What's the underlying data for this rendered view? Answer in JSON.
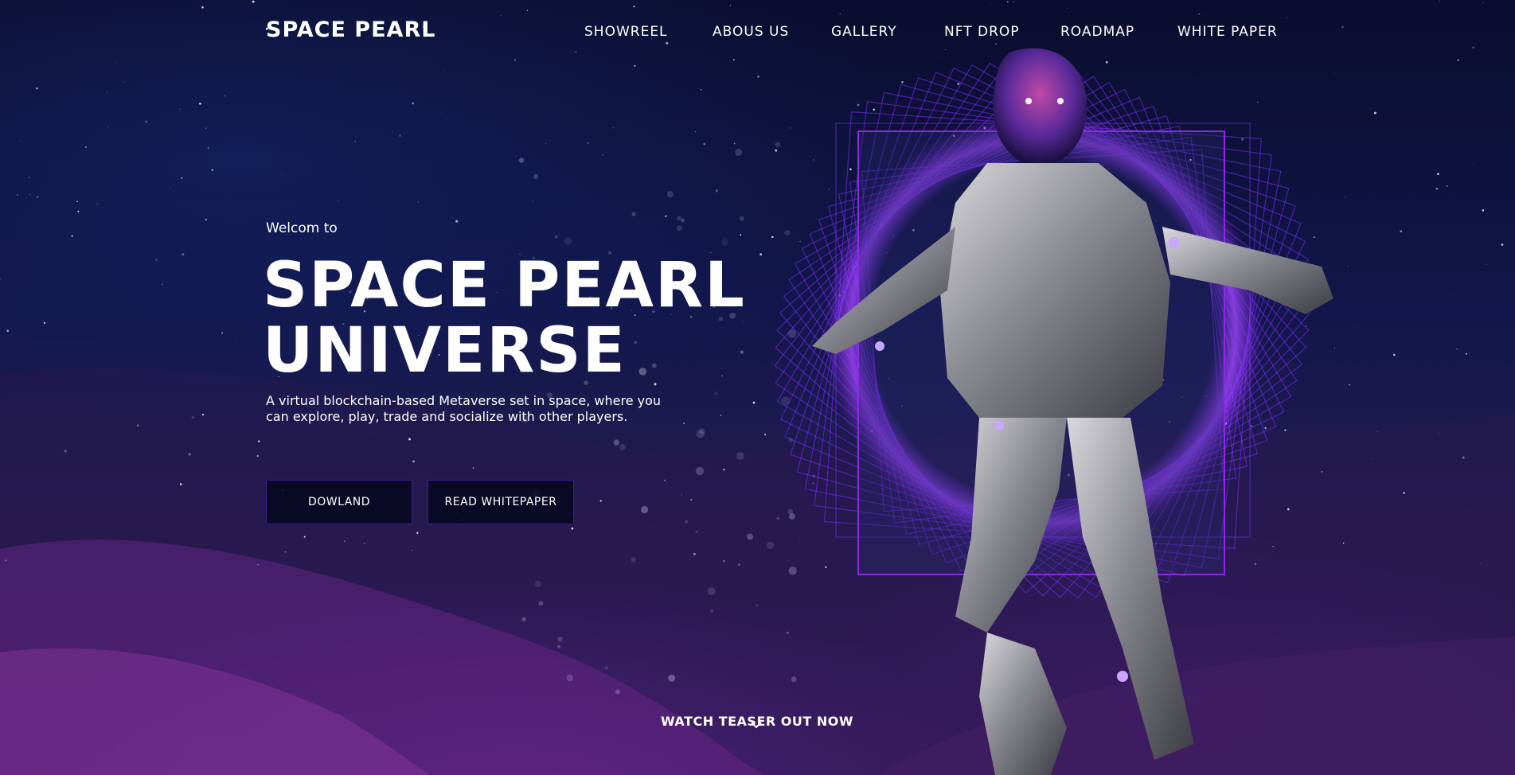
{
  "brand": {
    "logo": "SPACE PEARL"
  },
  "nav": {
    "items": [
      {
        "label": "SHOWREEL"
      },
      {
        "label": "ABOUS US"
      },
      {
        "label": "GALLERY"
      },
      {
        "label": "NFT DROP"
      },
      {
        "label": "ROADMAP"
      },
      {
        "label": "WHITE PAPER"
      }
    ]
  },
  "hero": {
    "welcome": "Welcom to",
    "title_line1": "SPACE PEARL",
    "title_line2": "UNIVERSE",
    "description": "A virtual blockchain-based Metaverse set in space, where you can explore, play, trade and socialize with other players.",
    "buttons": {
      "download": "DOWLAND",
      "whitepaper": "READ WHITEPAPER"
    },
    "teaser": "WATCH TEASER OUT NOW"
  },
  "colors": {
    "accent": "#7b2cff",
    "frame": "#8a2be2",
    "button_border": "#3a1d8a",
    "text": "#ffffff"
  },
  "icons": {
    "teaser": "chevron-down-icon",
    "hero_art": "astronaut-figure"
  }
}
